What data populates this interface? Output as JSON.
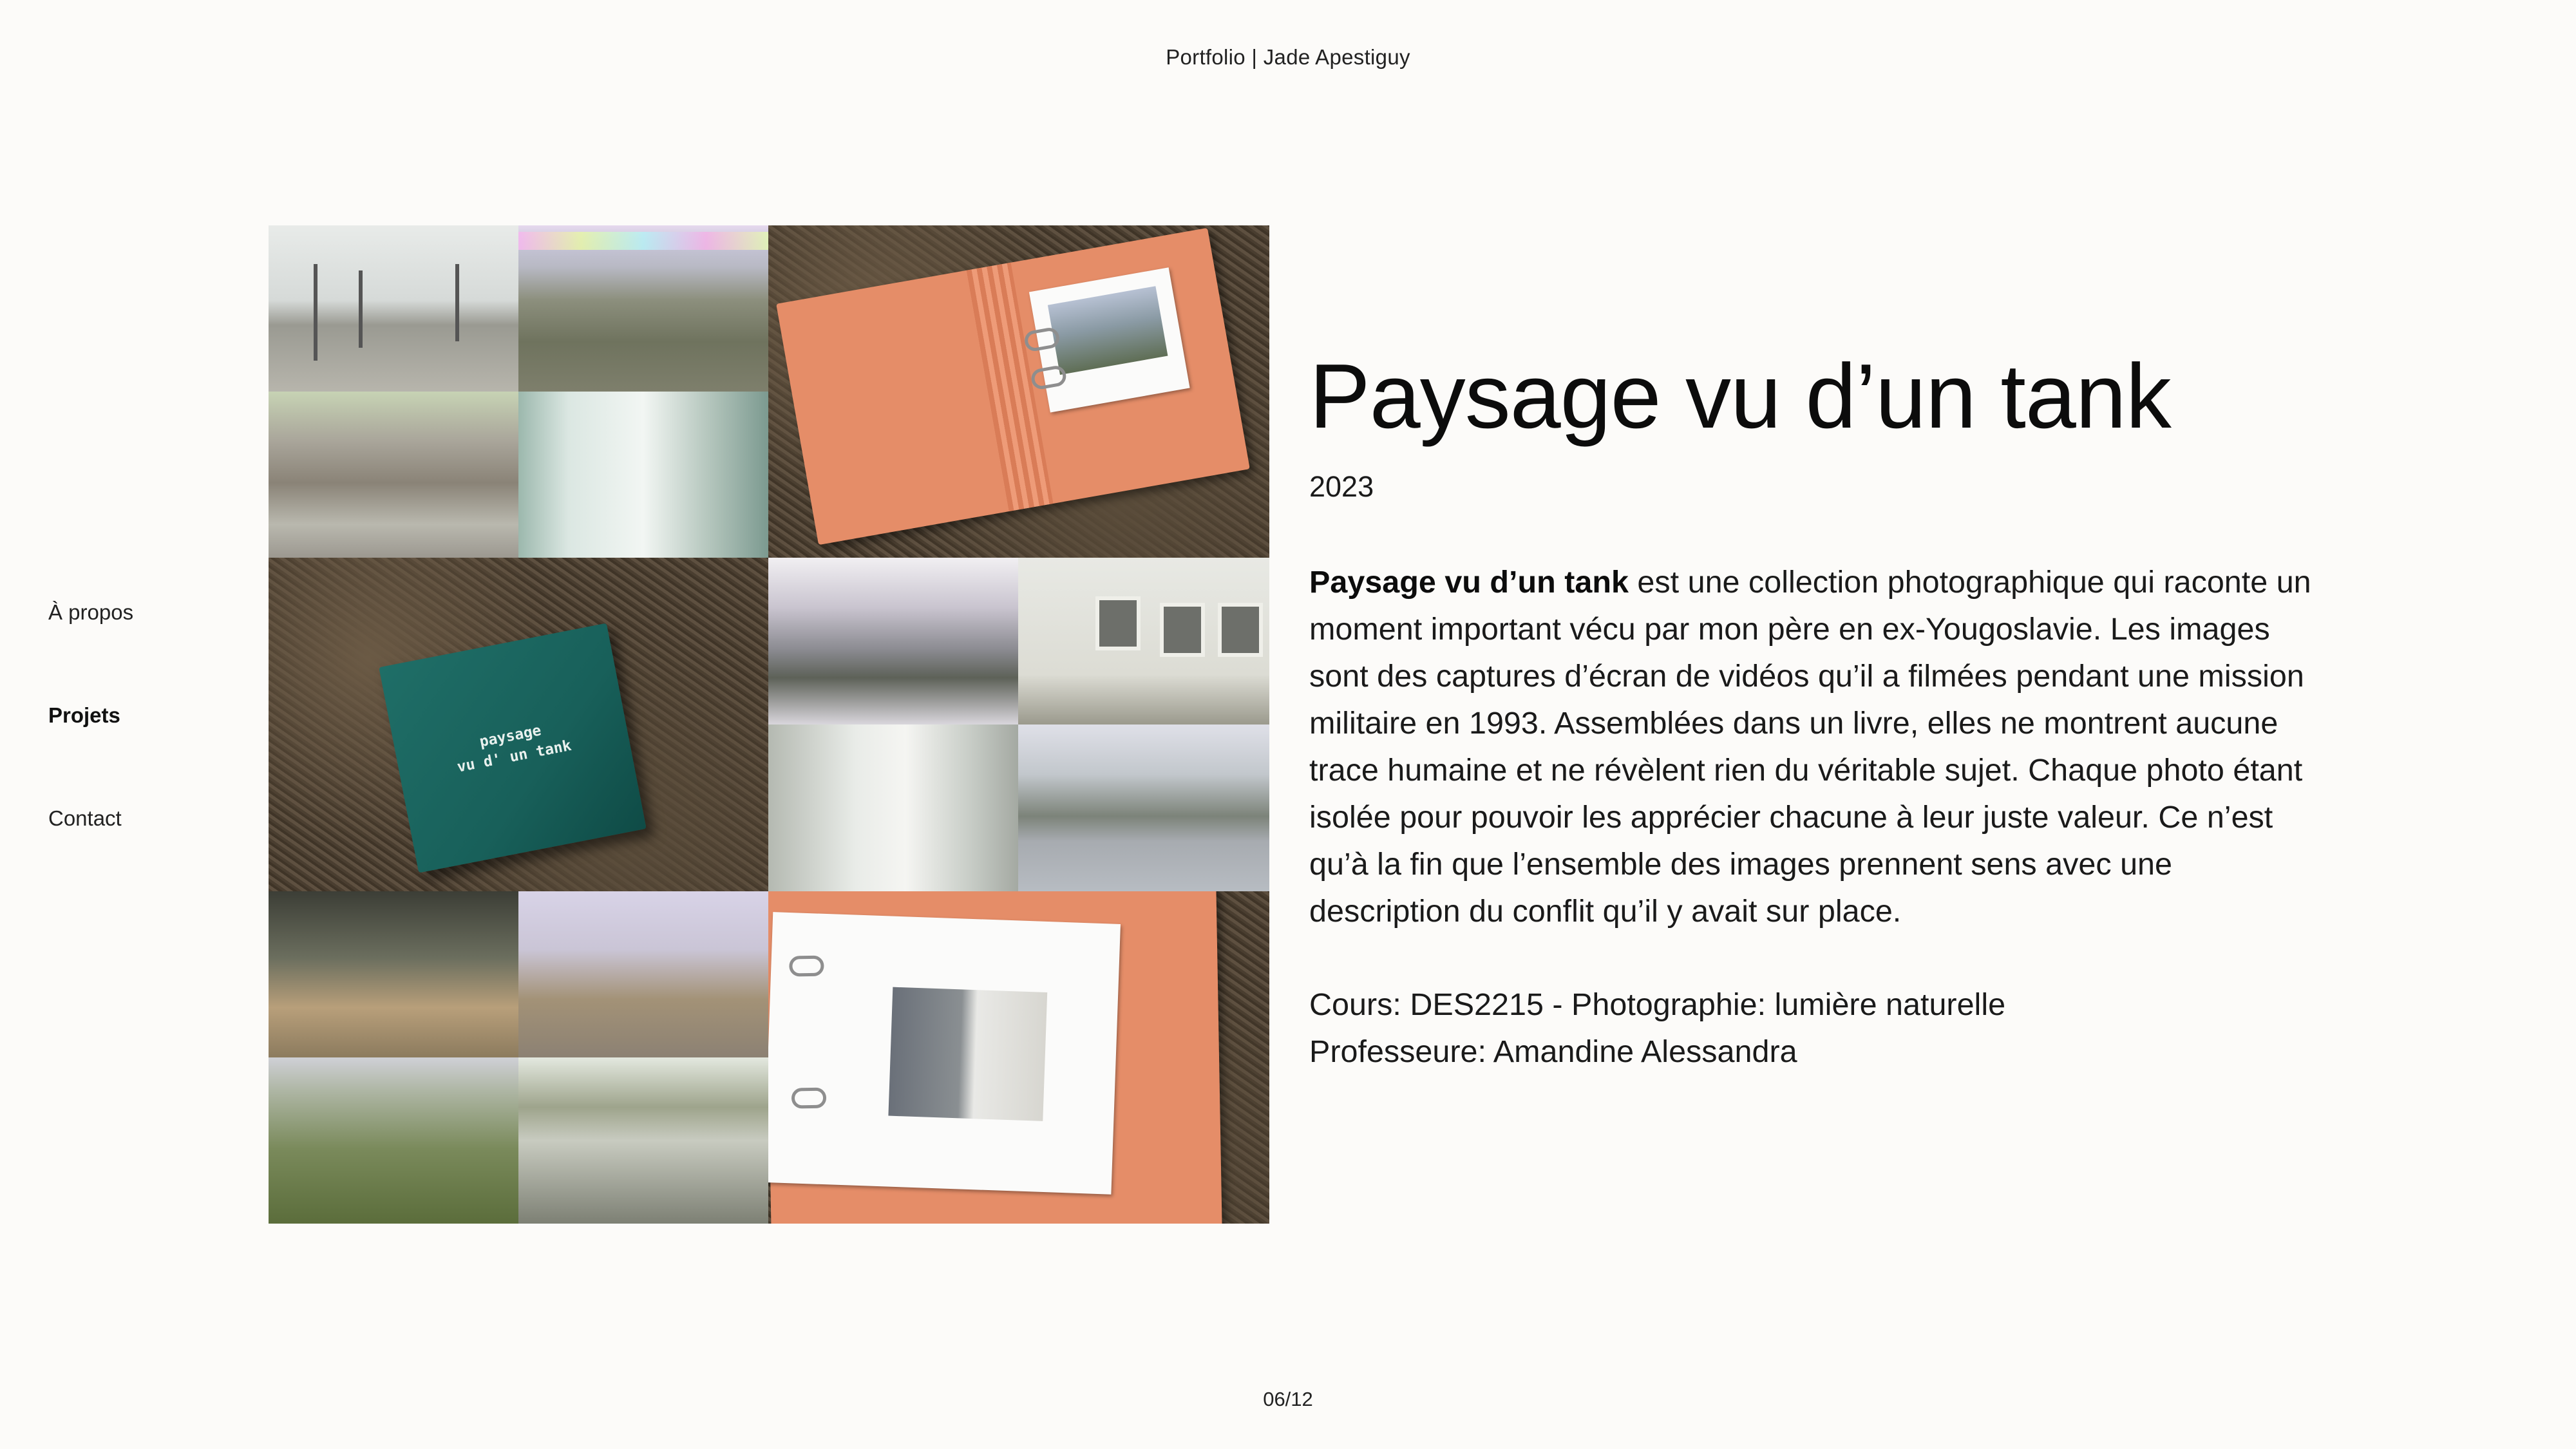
{
  "header": {
    "title": "Portfolio | Jade Apestiguy"
  },
  "nav": {
    "items": [
      {
        "label": "À propos"
      },
      {
        "label": "Projets",
        "active": true
      },
      {
        "label": "Contact"
      }
    ]
  },
  "collage": {
    "green_book_cover_line1": "paysage",
    "green_book_cover_line2": "vu d' un tank"
  },
  "project": {
    "title": "Paysage vu d’un tank",
    "year": "2023",
    "description_lead": "Paysage vu d’un tank",
    "description_rest": " est une collection photographique qui raconte un moment important vécu par mon père en ex-Yougoslavie. Les images sont des captures d’écran de vidéos qu’il a filmées pendant une mission militaire en 1993. Assemblées dans un livre, elles ne montrent aucune trace humaine et ne révèlent rien du véritable sujet. Chaque photo étant isolée pour pouvoir les apprécier chacune à leur juste valeur. Ce n’est qu’à la fin que l’ensemble des images prennent sens avec une description du conflit qu’il y avait sur place.",
    "course": "Cours: DES2215 - Photographie: lumière naturelle",
    "professor": "Professeure: Amandine Alessandra"
  },
  "pagination": {
    "counter": "06/12"
  },
  "colors": {
    "background": "#fcfbf9",
    "text": "#111111",
    "book_orange": "#e58d68",
    "book_green": "#1f6e67"
  }
}
